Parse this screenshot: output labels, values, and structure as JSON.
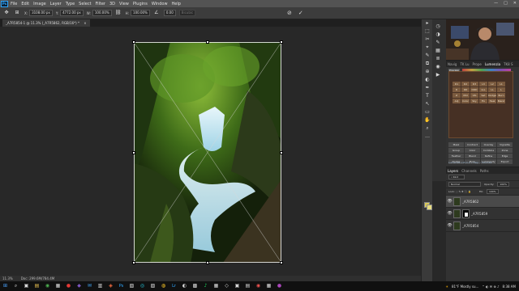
{
  "menubar": {
    "logo": "Ps",
    "items": [
      "File",
      "Edit",
      "Image",
      "Layer",
      "Type",
      "Select",
      "Filter",
      "3D",
      "View",
      "Plugins",
      "Window",
      "Help"
    ],
    "window_controls": [
      "—",
      "□",
      "✕"
    ]
  },
  "options": {
    "x_label": "X:",
    "x_value": "3108.00 px",
    "y_label": "Y:",
    "y_value": "4772.00 px",
    "w_label": "W:",
    "w_value": "100.00%",
    "h_label": "H:",
    "h_value": "100.00%",
    "angle_value": "0.00",
    "interp_value": "Bicubic",
    "cancel_icon": "⊘",
    "commit_icon": "✓"
  },
  "document": {
    "tab_title": "_A7R5854-1 @ 11.3% (_A7R5862, RGB/16*) *",
    "close_glyph": "×"
  },
  "status": {
    "zoom": "11.3%",
    "doc_size": "Doc: 299.6M/784.4M"
  },
  "tools": [
    "▸",
    "⬚",
    "✂",
    "⌖",
    "✎",
    "⧉",
    "⊕",
    "◐",
    "✒",
    "T",
    "↖",
    "▭",
    "✋",
    "⌕",
    "…"
  ],
  "lumenzia": {
    "tabs": [
      "Navig",
      "TK Lu",
      "Prope",
      "Lumenzia",
      "TK8 S"
    ],
    "preview_label": "Preview",
    "cells": [
      "D1",
      "D2",
      "D3",
      "L3",
      "L2",
      "L1",
      "D",
      "DD",
      "DDD",
      "LLL",
      "LL",
      "L",
      "Z",
      "Mid",
      "Vib",
      "Sat",
      "Dodge",
      "Burn",
      "Adj",
      "Color",
      "Sky",
      "Fix",
      "Heal",
      "Blend"
    ],
    "buttons": [
      "Mask",
      "Contract",
      "Overlay",
      "Vignette",
      "Group",
      "Color",
      "Combine",
      "Zone",
      "Feather",
      "Blend",
      "Refine",
      "Edge",
      "Dodge",
      "Burn",
      "Luminosity",
      "Export"
    ],
    "footer": "Lumenzia v10.0.0  •  Help  •  Tutorials"
  },
  "layers": {
    "tabs": [
      "Layers",
      "Channels",
      "Paths"
    ],
    "blend_mode": "Normal",
    "opacity_label": "Opacity:",
    "opacity_value": "100%",
    "fill_label": "Fill:",
    "fill_value": "100%",
    "rows": [
      {
        "name": "_A7R5862"
      },
      {
        "name": "_A7R5859"
      },
      {
        "name": "_A7R5854"
      }
    ]
  },
  "taskbar": {
    "icons": [
      "⊞",
      "⌕",
      "▣",
      "▤",
      "◉",
      "▦",
      "●",
      "◆",
      "✉",
      "▥",
      "◈",
      "Ps",
      "▧",
      "◎",
      "▨",
      "◍",
      "Lr",
      "◐",
      "▩",
      "♪",
      "▦",
      "◇",
      "▣",
      "▤",
      "◉",
      "▦",
      "●"
    ],
    "weather": "81°F  Mostly su...",
    "time": "8:38 AM"
  },
  "colors": {
    "accent": "#31a8ff",
    "panel": "#323232",
    "canvas_bg": "#282828",
    "menubar": "#535353",
    "lumenzia_bg": "#463024"
  }
}
